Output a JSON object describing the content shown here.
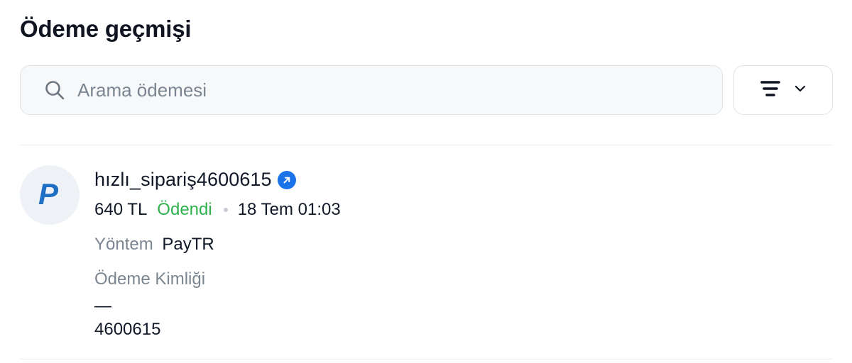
{
  "header": {
    "title": "Ödeme geçmişi"
  },
  "search": {
    "placeholder": "Arama ödemesi",
    "value": "",
    "icon": "search-icon"
  },
  "filter": {
    "icon": "filter-lines-icon",
    "chevron_icon": "chevron-down-icon"
  },
  "payments": [
    {
      "provider_icon": "paypal-icon",
      "order_name": "hızlı_sipariş4600615",
      "link_icon": "external-link-icon",
      "amount": "640 TL",
      "status": "Ödendi",
      "date": "18 Tem 01:03",
      "method_label": "Yöntem",
      "method_value": "PayTR",
      "payment_id_label": "Ödeme Kimliği",
      "payment_id_dash": "—",
      "payment_id_value": "4600615"
    }
  ],
  "colors": {
    "accent_blue": "#1a73e8",
    "paid_green": "#2fb24c",
    "muted_text": "#7a8591",
    "paypal_blue": "#1f6fc5"
  }
}
